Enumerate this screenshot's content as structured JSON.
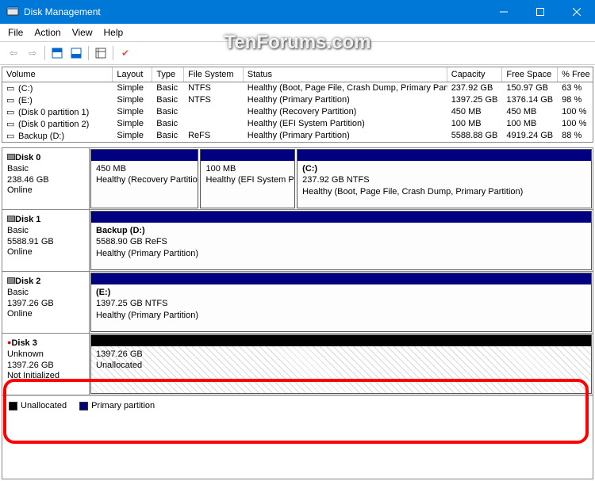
{
  "window": {
    "title": "Disk Management"
  },
  "menu": {
    "file": "File",
    "action": "Action",
    "view": "View",
    "help": "Help"
  },
  "watermark": "TenForums.com",
  "columns": {
    "volume": "Volume",
    "layout": "Layout",
    "type": "Type",
    "fs": "File System",
    "status": "Status",
    "capacity": "Capacity",
    "free": "Free Space",
    "pct": "% Free"
  },
  "volumes": [
    {
      "name": "(C:)",
      "layout": "Simple",
      "type": "Basic",
      "fs": "NTFS",
      "status": "Healthy (Boot, Page File, Crash Dump, Primary Partition)",
      "cap": "237.92 GB",
      "free": "150.97 GB",
      "pct": "63 %"
    },
    {
      "name": "(E:)",
      "layout": "Simple",
      "type": "Basic",
      "fs": "NTFS",
      "status": "Healthy (Primary Partition)",
      "cap": "1397.25 GB",
      "free": "1376.14 GB",
      "pct": "98 %"
    },
    {
      "name": "(Disk 0 partition 1)",
      "layout": "Simple",
      "type": "Basic",
      "fs": "",
      "status": "Healthy (Recovery Partition)",
      "cap": "450 MB",
      "free": "450 MB",
      "pct": "100 %"
    },
    {
      "name": "(Disk 0 partition 2)",
      "layout": "Simple",
      "type": "Basic",
      "fs": "",
      "status": "Healthy (EFI System Partition)",
      "cap": "100 MB",
      "free": "100 MB",
      "pct": "100 %"
    },
    {
      "name": "Backup (D:)",
      "layout": "Simple",
      "type": "Basic",
      "fs": "ReFS",
      "status": "Healthy (Primary Partition)",
      "cap": "5588.88 GB",
      "free": "4919.24 GB",
      "pct": "88 %"
    }
  ],
  "disks": [
    {
      "name": "Disk 0",
      "type": "Basic",
      "size": "238.46 GB",
      "status": "Online",
      "parts": [
        {
          "label": "",
          "info": "450 MB",
          "detail": "Healthy (Recovery Partition)",
          "kind": "primary",
          "flex": 0.8
        },
        {
          "label": "",
          "info": "100 MB",
          "detail": "Healthy (EFI System Partition)",
          "kind": "primary",
          "flex": 0.7
        },
        {
          "label": "(C:)",
          "info": "237.92 GB NTFS",
          "detail": "Healthy (Boot, Page File, Crash Dump, Primary Partition)",
          "kind": "primary",
          "flex": 2.2
        }
      ]
    },
    {
      "name": "Disk 1",
      "type": "Basic",
      "size": "5588.91 GB",
      "status": "Online",
      "parts": [
        {
          "label": "Backup  (D:)",
          "info": "5588.90 GB ReFS",
          "detail": "Healthy (Primary Partition)",
          "kind": "primary",
          "flex": 1
        }
      ]
    },
    {
      "name": "Disk 2",
      "type": "Basic",
      "size": "1397.26 GB",
      "status": "Online",
      "parts": [
        {
          "label": "(E:)",
          "info": "1397.25 GB NTFS",
          "detail": "Healthy (Primary Partition)",
          "kind": "primary",
          "flex": 1
        }
      ]
    },
    {
      "name": "Disk 3",
      "type": "Unknown",
      "size": "1397.26 GB",
      "status": "Not Initialized",
      "parts": [
        {
          "label": "",
          "info": "1397.26 GB",
          "detail": "Unallocated",
          "kind": "unalloc",
          "flex": 1
        }
      ]
    }
  ],
  "legend": {
    "unallocated": "Unallocated",
    "primary": "Primary partition"
  }
}
